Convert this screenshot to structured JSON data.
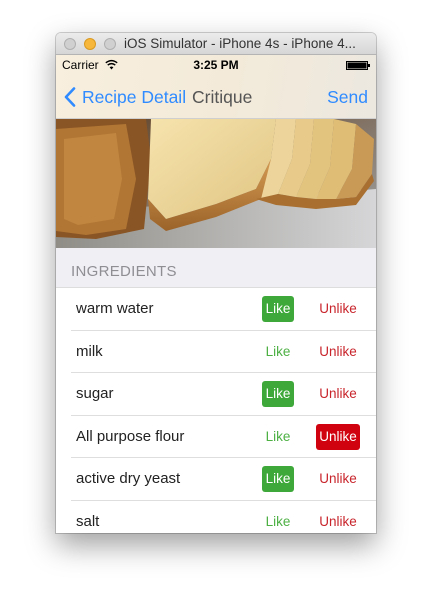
{
  "window": {
    "title": "iOS Simulator - iPhone 4s - iPhone 4..."
  },
  "status_bar": {
    "carrier": "Carrier",
    "time": "3:25 PM",
    "wifi_icon": "wifi-icon",
    "battery_icon": "battery-full-icon"
  },
  "nav": {
    "back_label": "Recipe Detail",
    "title": "Critique",
    "send_label": "Send",
    "back_icon": "chevron-left-icon"
  },
  "image": {
    "subject": "sliced bread loaf photo"
  },
  "section": {
    "title": "INGREDIENTS"
  },
  "ingredients": [
    {
      "name": "warm water",
      "like_label": "Like",
      "unlike_label": "Unlike",
      "liked": true,
      "unliked": false
    },
    {
      "name": "milk",
      "like_label": "Like",
      "unlike_label": "Unlike",
      "liked": false,
      "unliked": false
    },
    {
      "name": "sugar",
      "like_label": "Like",
      "unlike_label": "Unlike",
      "liked": true,
      "unliked": false
    },
    {
      "name": "All purpose flour",
      "like_label": "Like",
      "unlike_label": "Unlike",
      "liked": false,
      "unliked": true
    },
    {
      "name": "active dry yeast",
      "like_label": "Like",
      "unlike_label": "Unlike",
      "liked": true,
      "unliked": false
    },
    {
      "name": "salt",
      "like_label": "Like",
      "unlike_label": "Unlike",
      "liked": false,
      "unliked": false
    }
  ],
  "colors": {
    "accent_blue": "#2f8bff",
    "like_green": "#3ea83a",
    "unlike_red": "#d0020f",
    "section_background": "#efeff4"
  }
}
